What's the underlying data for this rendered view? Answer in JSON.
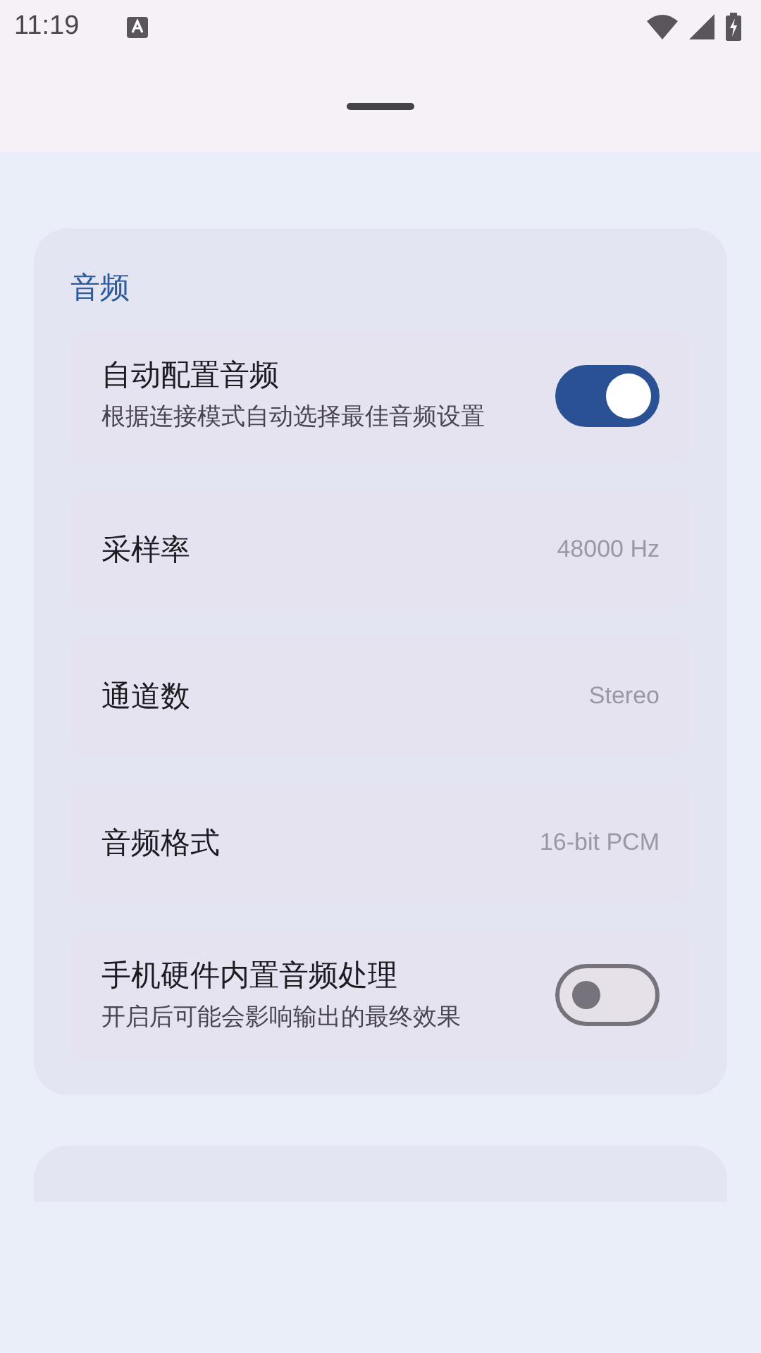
{
  "status_bar": {
    "time": "11:19"
  },
  "sections": [
    {
      "title": "音频",
      "items": [
        {
          "kind": "switch",
          "label": "自动配置音频",
          "description": "根据连接模式自动选择最佳音频设置",
          "on": true
        },
        {
          "kind": "value",
          "label": "采样率",
          "value": "48000 Hz"
        },
        {
          "kind": "value",
          "label": "通道数",
          "value": "Stereo"
        },
        {
          "kind": "value",
          "label": "音频格式",
          "value": "16-bit PCM"
        },
        {
          "kind": "switch",
          "label": "手机硬件内置音频处理",
          "description": "开启后可能会影响输出的最终效果",
          "on": false
        }
      ]
    }
  ]
}
